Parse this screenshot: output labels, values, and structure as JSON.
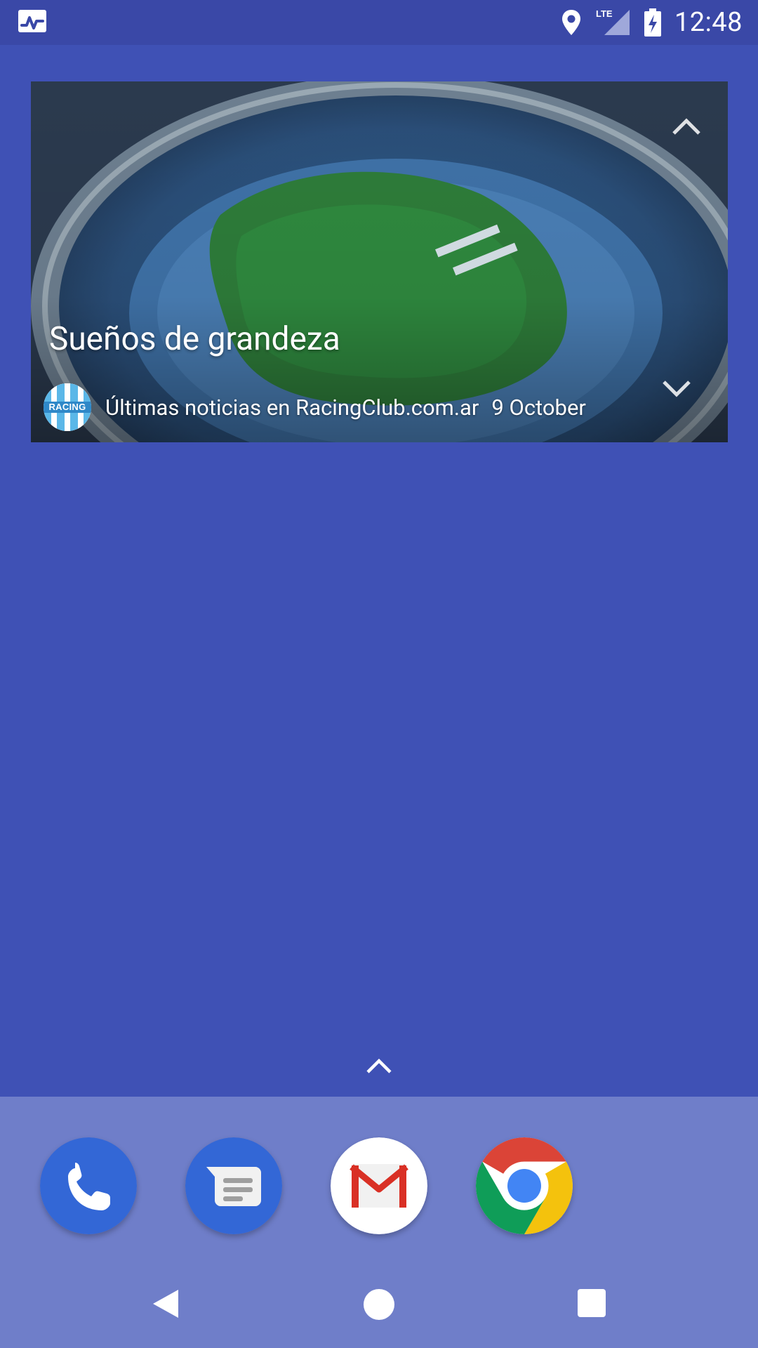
{
  "status_bar": {
    "time": "12:48",
    "network": "LTE",
    "icons": [
      "activity-monitor-icon",
      "location-icon",
      "lte-signal-icon",
      "battery-charging-icon"
    ]
  },
  "widget": {
    "title": "Sueños de grandeza",
    "source": "Últimas noticias en RacingClub.com.ar",
    "date": "9 October",
    "logo_text": "RACING",
    "arrows": [
      "chevron-up-icon",
      "chevron-down-icon"
    ]
  },
  "home": {
    "all_apps_indicator": "chevron-up-icon"
  },
  "dock": {
    "apps": [
      "Phone",
      "Messages",
      "Gmail",
      "Chrome"
    ]
  },
  "nav_bar": {
    "buttons": [
      "back",
      "home",
      "recents"
    ]
  },
  "colors": {
    "wallpaper": "#3f51b5",
    "status_bar": "#3a48a7",
    "dock": "#6f7ec9",
    "phone_icon": "#3367d6",
    "messages_icon": "#3367d6"
  }
}
